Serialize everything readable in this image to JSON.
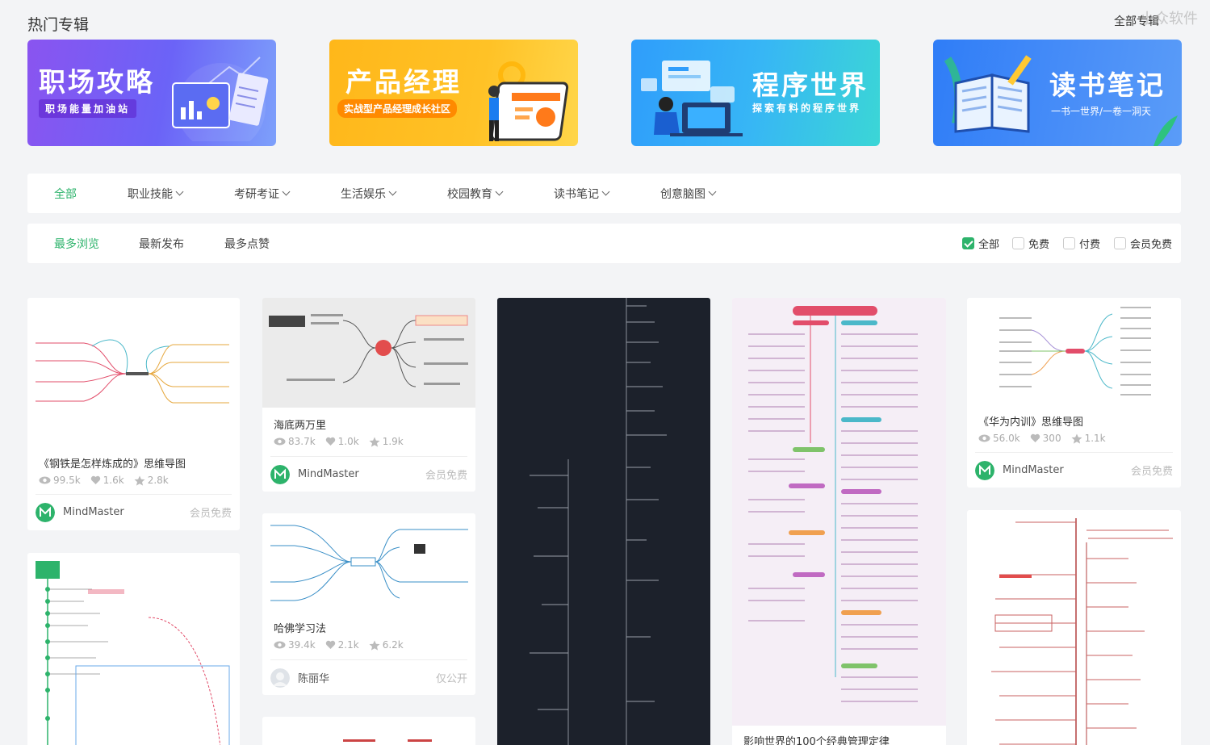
{
  "header": {
    "title": "热门专辑",
    "all_albums": "全部专辑",
    "watermark": "小众软件"
  },
  "banners": [
    {
      "title": "职场攻略",
      "subtitle": "职场能量加油站"
    },
    {
      "title": "产品经理",
      "subtitle": "实战型产品经理成长社区"
    },
    {
      "title": "程序世界",
      "subtitle": "探索有料的程序世界"
    },
    {
      "title": "读书笔记",
      "subtitle": "一书一世界/一卷一洞天"
    }
  ],
  "categories": [
    {
      "label": "全部",
      "active": true
    },
    {
      "label": "职业技能",
      "dropdown": true
    },
    {
      "label": "考研考证",
      "dropdown": true
    },
    {
      "label": "生活娱乐",
      "dropdown": true
    },
    {
      "label": "校园教育",
      "dropdown": true
    },
    {
      "label": "读书笔记",
      "dropdown": true
    },
    {
      "label": "创意脑图",
      "dropdown": true
    }
  ],
  "sort_tabs": [
    {
      "label": "最多浏览",
      "active": true
    },
    {
      "label": "最新发布"
    },
    {
      "label": "最多点赞"
    }
  ],
  "filters": [
    {
      "label": "全部",
      "checked": true
    },
    {
      "label": "免费",
      "checked": false
    },
    {
      "label": "付费",
      "checked": false
    },
    {
      "label": "会员免费",
      "checked": false
    }
  ],
  "cards": [
    {
      "title": "《钢铁是怎样炼成的》思维导图",
      "views": "99.5k",
      "likes": "1.6k",
      "stars": "2.8k",
      "author": "MindMaster",
      "price": "会员免费"
    },
    {
      "title": "海底两万里",
      "views": "83.7k",
      "likes": "1.0k",
      "stars": "1.9k",
      "author": "MindMaster",
      "price": "会员免费"
    },
    {
      "title": "哈佛学习法",
      "views": "39.4k",
      "likes": "2.1k",
      "stars": "6.2k",
      "author": "陈丽华",
      "price": "仅公开"
    },
    {
      "title": "影响世界的100个经典管理定律"
    },
    {
      "title": "《华为内训》思维导图",
      "views": "56.0k",
      "likes": "300",
      "stars": "1.1k",
      "author": "MindMaster",
      "price": "会员免费"
    }
  ],
  "colors": {
    "accent": "#2db36b"
  }
}
